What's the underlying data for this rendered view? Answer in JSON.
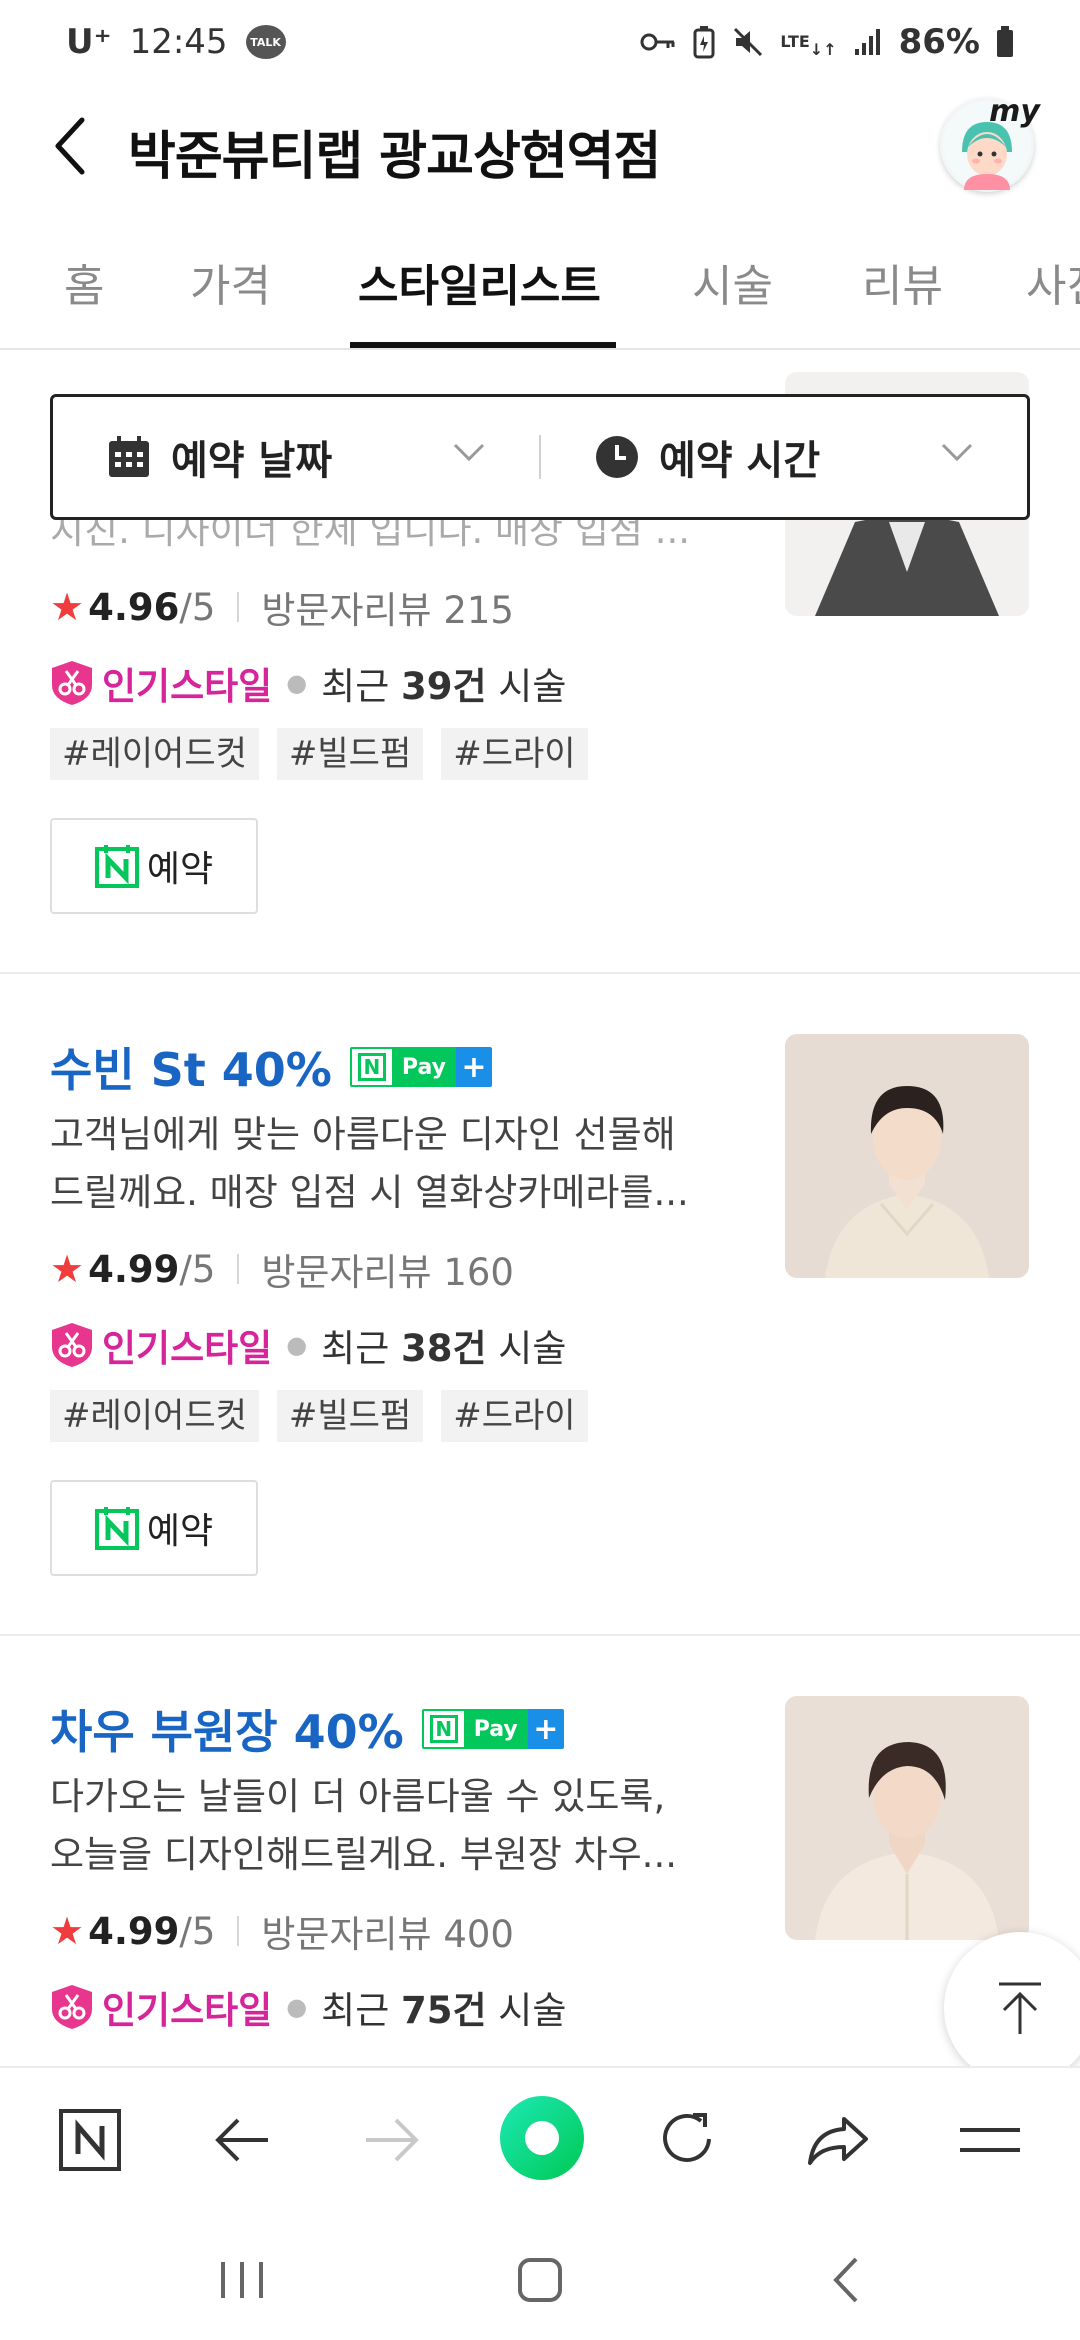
{
  "status_bar": {
    "carrier": "U⁺",
    "time": "12:45",
    "talk_badge": "TALK",
    "network": "LTE",
    "battery": "86%"
  },
  "header": {
    "title": "박준뷰티랩 광교상현역점",
    "my_label": "my"
  },
  "tabs": [
    {
      "label": "홈"
    },
    {
      "label": "가격"
    },
    {
      "label": "스타일리스트",
      "active": true
    },
    {
      "label": "시술"
    },
    {
      "label": "리뷰"
    },
    {
      "label": "사진"
    }
  ],
  "filters": {
    "date_label": "예약 날짜",
    "time_label": "예약 시간"
  },
  "cards": [
    {
      "desc_line2": "지친. 디자이너 한세 입니다. 매장 입점 ...",
      "rating": "4.96",
      "rating_max": "/5",
      "reviews": "방문자리뷰 215",
      "popular": "인기스타일",
      "recent_prefix": "최근 ",
      "recent_count": "39건",
      "recent_suffix": " 시술",
      "tags": [
        "#레이어드컷",
        "#빌드펌",
        "#드라이"
      ],
      "book_label": "예약"
    },
    {
      "name": "수빈 St 40%",
      "desc_line1": "고객님에게 맞는 아름다운 디자인 선물해",
      "desc_line2": "드릴께요. 매장 입점 시 열화상카메라를...",
      "rating": "4.99",
      "rating_max": "/5",
      "reviews": "방문자리뷰 160",
      "popular": "인기스타일",
      "recent_prefix": "최근 ",
      "recent_count": "38건",
      "recent_suffix": " 시술",
      "tags": [
        "#레이어드컷",
        "#빌드펌",
        "#드라이"
      ],
      "book_label": "예약"
    },
    {
      "name": "차우 부원장 40%",
      "desc_line1": "다가오는 날들이 더 아름다울 수 있도록,",
      "desc_line2": "오늘을 디자인해드릴게요. 부원장 차우...",
      "rating": "4.99",
      "rating_max": "/5",
      "reviews": "방문자리뷰 400",
      "popular": "인기스타일",
      "recent_prefix": "최근 ",
      "recent_count": "75건",
      "recent_suffix": " 시술"
    }
  ],
  "npay": {
    "n": "N",
    "text": "Pay",
    "plus": "+"
  },
  "colors": {
    "name_blue": "#1965c3",
    "popular_pink": "#d6249a",
    "naver_green": "#03c75a",
    "star_red": "#f03c3c"
  },
  "icons": [
    "back-arrow-icon",
    "calendar-icon",
    "clock-icon",
    "chevron-down-icon",
    "scissors-badge-icon",
    "naver-calendar-icon",
    "arrow-up-icon",
    "naver-n-icon",
    "back-icon",
    "forward-icon",
    "home-icon",
    "refresh-icon",
    "share-icon",
    "menu-icon"
  ]
}
